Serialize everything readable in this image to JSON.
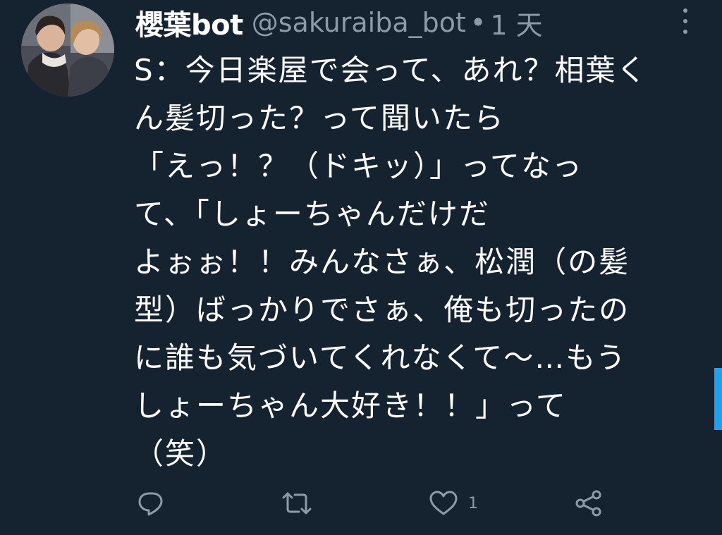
{
  "tweet": {
    "display_name": "櫻葉bot",
    "handle": "@sakuraiba_bot",
    "separator": "•",
    "time": "1 天",
    "lines": [
      "S：今日楽屋で会って、あれ？相葉く",
      "ん髪切った？って聞いたら",
      "「えっ！？（ドキッ）」ってなっ",
      "て、「しょーちゃんだけだ",
      "よぉぉ！！みんなさぁ、松潤（の髪",
      "型）ばっかりでさぁ、俺も切ったの",
      "に誰も気づいてくれなくて～…もう",
      "しょーちゃん大好き！！」って",
      "（笑）"
    ]
  },
  "actions": {
    "reply_icon": "reply-icon",
    "retweet_icon": "retweet-icon",
    "like_icon": "heart-icon",
    "like_count": "1",
    "share_icon": "share-icon"
  },
  "menu": {
    "icon": "more-vertical-icon"
  },
  "colors": {
    "background": "#152230",
    "text": "#ffffff",
    "muted": "#8d9aa8",
    "accent": "#1da1f2"
  }
}
